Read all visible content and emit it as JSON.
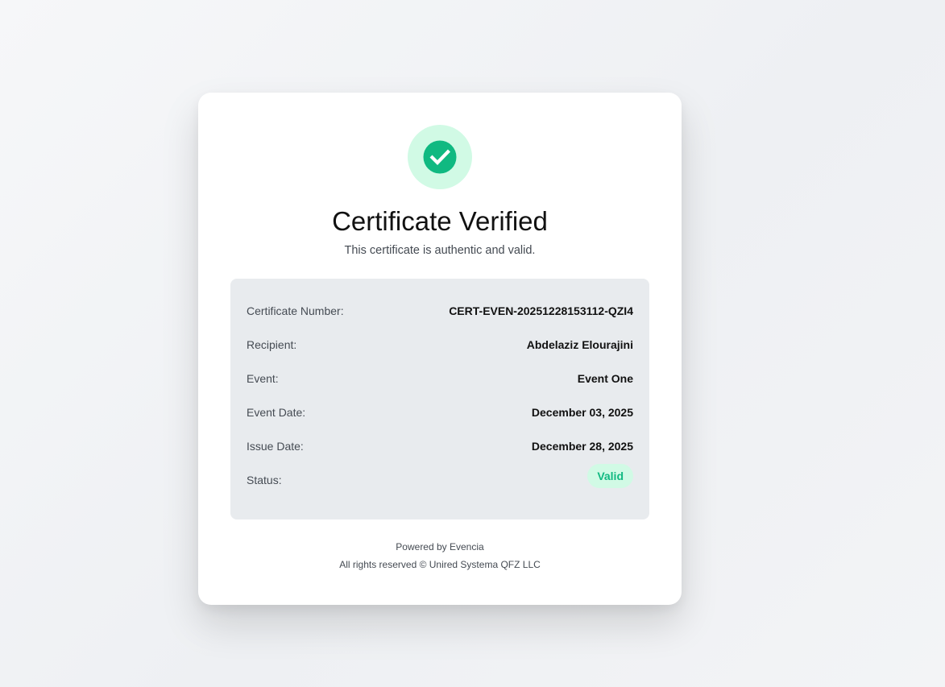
{
  "colors": {
    "accent_green": "#10b981",
    "accent_green_light": "#d1fae5",
    "panel_bg": "#e8ebee",
    "card_bg": "#ffffff"
  },
  "header": {
    "icon": "check-circle-icon",
    "title": "Certificate Verified",
    "subtitle": "This certificate is authentic and valid."
  },
  "details": {
    "certificate_number": {
      "label": "Certificate Number:",
      "value": "CERT-EVEN-20251228153112-QZI4"
    },
    "recipient": {
      "label": "Recipient:",
      "value": "Abdelaziz Elourajini"
    },
    "event": {
      "label": "Event:",
      "value": "Event One"
    },
    "event_date": {
      "label": "Event Date:",
      "value": "December 03, 2025"
    },
    "issue_date": {
      "label": "Issue Date:",
      "value": "December 28, 2025"
    },
    "status": {
      "label": "Status:",
      "value": "Valid"
    }
  },
  "footer": {
    "powered_by": "Powered by Evencia",
    "copyright": "All rights reserved © Unired Systema QFZ LLC"
  }
}
